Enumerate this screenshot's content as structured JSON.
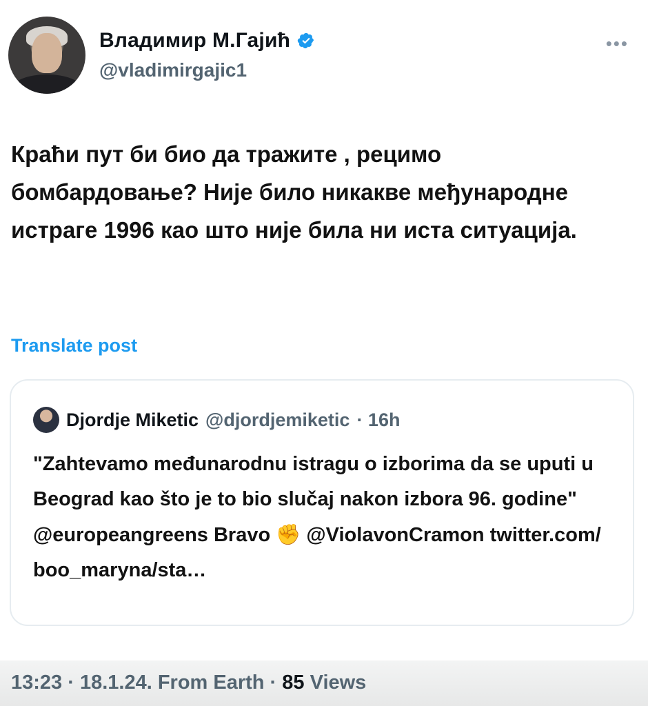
{
  "author": {
    "name": "Владимир М.Гајић",
    "handle": "@vladimirgajic1",
    "verified": true
  },
  "post": {
    "text": "Краћи пут би био да тражите , рецимо бомбардовање? Није било никакве међународне истраге 1996 као што није била ни иста ситуација.",
    "translate_label": "Translate post"
  },
  "quoted": {
    "name": "Djordje Miketic",
    "handle": "@djordjemiketic",
    "time": "· 16h",
    "text_before_emoji": "\"Zahtevamo međunarodnu istragu o izborima da se uputi u Beograd kao što je to bio slučaj nakon izbora 96. godine\" @europeangreens Bravo ",
    "emoji": "✊",
    "text_after_emoji": " @ViolavonCramon twitter.com/ boo_maryna/sta…"
  },
  "footer": {
    "time": "13:23",
    "date": "· 18.1.24. From Earth ·",
    "views_count": "85",
    "views_label": "Views"
  },
  "colors": {
    "accent": "#1d9bf0",
    "muted": "#536471",
    "text": "#0f1419"
  }
}
